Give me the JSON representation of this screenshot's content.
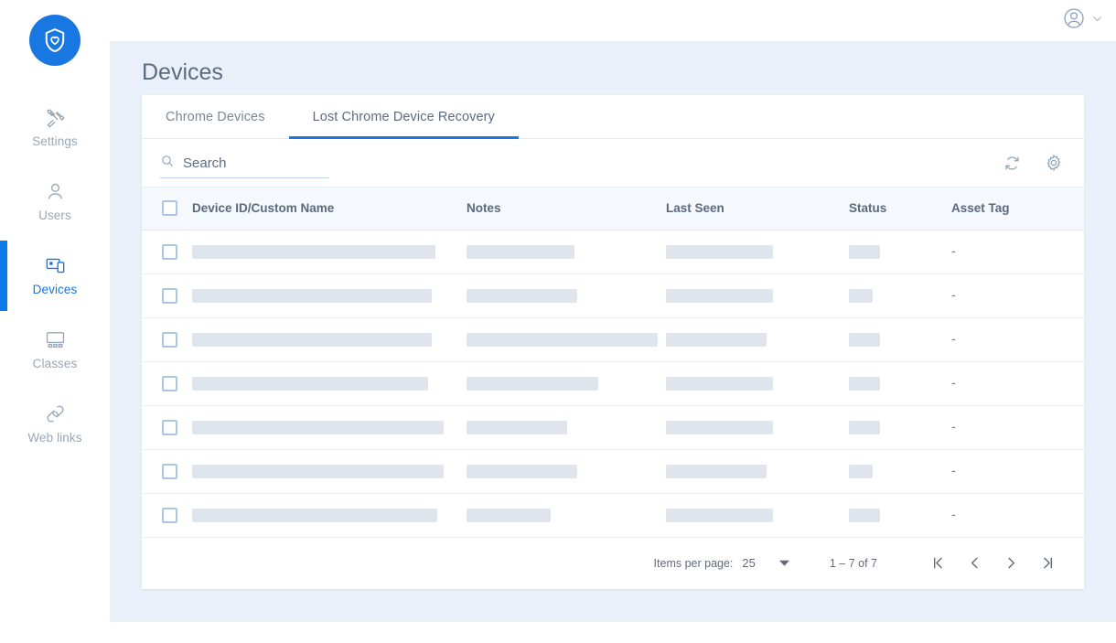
{
  "brand": {
    "logo_icon": "shield-heart-icon",
    "accent_color": "#1877e0"
  },
  "sidebar": {
    "items": [
      {
        "label": "Settings",
        "icon": "tools-icon",
        "active": false
      },
      {
        "label": "Users",
        "icon": "person-icon",
        "active": false
      },
      {
        "label": "Devices",
        "icon": "devices-icon",
        "active": true
      },
      {
        "label": "Classes",
        "icon": "classes-icon",
        "active": false
      },
      {
        "label": "Web links",
        "icon": "link-icon",
        "active": false
      }
    ]
  },
  "topbar": {
    "avatar_icon": "account-circle-icon",
    "chevron_icon": "chevron-down-icon"
  },
  "page": {
    "title": "Devices"
  },
  "tabs": [
    {
      "label": "Chrome Devices",
      "active": false
    },
    {
      "label": "Lost Chrome Device Recovery",
      "active": true
    }
  ],
  "toolbar": {
    "search_placeholder": "Search",
    "search_value": "",
    "search_icon": "search-icon",
    "refresh_icon": "refresh-icon",
    "settings_icon": "gear-icon"
  },
  "table": {
    "columns": [
      {
        "key": "select",
        "label": ""
      },
      {
        "key": "name",
        "label": "Device ID/Custom Name"
      },
      {
        "key": "notes",
        "label": "Notes"
      },
      {
        "key": "seen",
        "label": "Last Seen"
      },
      {
        "key": "status",
        "label": "Status"
      },
      {
        "key": "asset",
        "label": "Asset Tag"
      }
    ],
    "loading": true,
    "rows": [
      {
        "asset": "-",
        "skeleton": {
          "name": 266,
          "notes": 118,
          "seen": 117,
          "status": 34
        }
      },
      {
        "asset": "-",
        "skeleton": {
          "name": 262,
          "notes": 121,
          "seen": 117,
          "status": 26
        }
      },
      {
        "asset": "-",
        "skeleton": {
          "name": 262,
          "notes": 209,
          "seen": 110,
          "status": 34
        }
      },
      {
        "asset": "-",
        "skeleton": {
          "name": 258,
          "notes": 144,
          "seen": 117,
          "status": 34
        }
      },
      {
        "asset": "-",
        "skeleton": {
          "name": 275,
          "notes": 110,
          "seen": 117,
          "status": 34
        }
      },
      {
        "asset": "-",
        "skeleton": {
          "name": 275,
          "notes": 121,
          "seen": 110,
          "status": 26
        }
      },
      {
        "asset": "-",
        "skeleton": {
          "name": 268,
          "notes": 92,
          "seen": 117,
          "status": 34
        }
      }
    ]
  },
  "paginator": {
    "items_per_page_label": "Items per page:",
    "items_per_page_value": "25",
    "range_label": "1 – 7 of 7",
    "first_icon": "first-page-icon",
    "prev_icon": "previous-page-icon",
    "next_icon": "next-page-icon",
    "last_icon": "last-page-icon"
  }
}
